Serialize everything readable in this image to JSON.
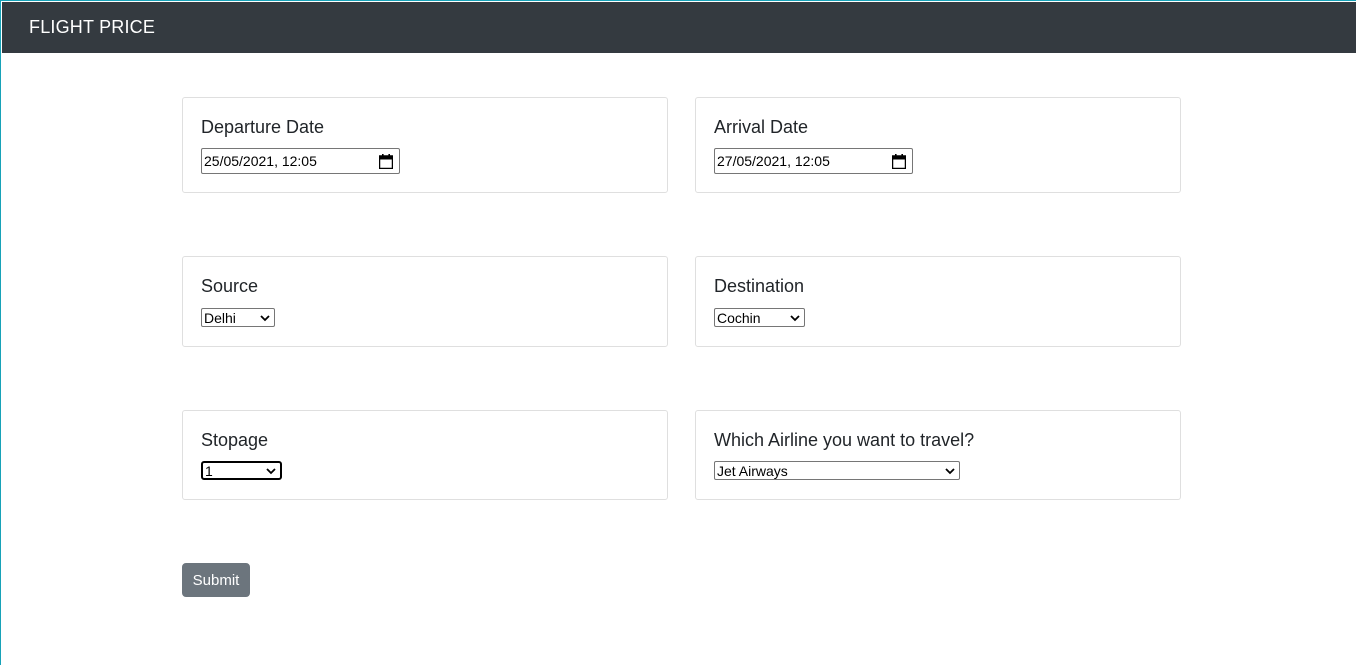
{
  "navbar": {
    "brand": "FLIGHT PRICE"
  },
  "form": {
    "departure": {
      "label": "Departure Date",
      "value": "25/05/2021, 12:05"
    },
    "arrival": {
      "label": "Arrival Date",
      "value": "27/05/2021, 12:05"
    },
    "source": {
      "label": "Source",
      "value": "Delhi"
    },
    "destination": {
      "label": "Destination",
      "value": "Cochin"
    },
    "stopage": {
      "label": "Stopage",
      "value": "1"
    },
    "airline": {
      "label": "Which Airline you want to travel?",
      "value": "Jet Airways"
    },
    "submit_label": "Submit"
  },
  "icons": {
    "date_picker": "calendar-icon",
    "dropdown": "chevron-down-icon"
  },
  "colors": {
    "navbar_bg": "#343a40",
    "button_bg": "#6c757d",
    "card_border": "#dfdfdf"
  }
}
